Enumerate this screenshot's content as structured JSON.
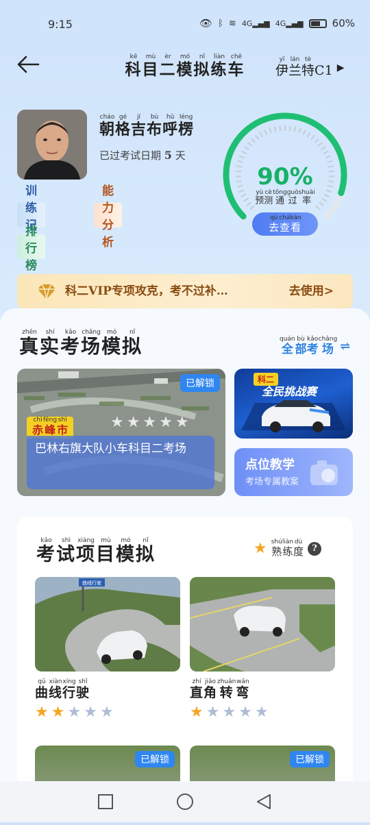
{
  "status_bar": {
    "time": "9:15",
    "battery": "60%",
    "signal1": "4G",
    "signal2": "4G"
  },
  "header": {
    "title": "科目二模拟练车",
    "title_pinyin": [
      "kē",
      "mù",
      "èr",
      "mó",
      "nǐ",
      "liàn",
      "chē"
    ],
    "vehicle": "伊兰特C1",
    "vehicle_pinyin": [
      "yī",
      "lán",
      "tè"
    ]
  },
  "profile": {
    "name": "朝格吉布呼楞",
    "name_pinyin": [
      "cháo",
      "gé",
      "jí",
      "bù",
      "hū",
      "léng"
    ],
    "days_text": "已过考试日期",
    "days_num": "5",
    "days_unit": "天"
  },
  "tabs": {
    "record": "训练记录",
    "ability": "能力分析",
    "rank": "排行榜"
  },
  "gauge": {
    "percent": "90%",
    "percent_value": 0.9,
    "label": "预测通过率",
    "label_pinyin": [
      "yù",
      "cè",
      "tōng",
      "guò",
      "shuài"
    ],
    "button": "去查看",
    "button_pinyin": [
      "qù",
      "chá",
      "kàn"
    ]
  },
  "vip": {
    "text": "科二VIP专项攻克，考不过补…",
    "use": "去使用>"
  },
  "section1": {
    "title": "真实考场模拟",
    "title_pinyin": [
      "zhēn",
      "shí",
      "kǎo",
      "chǎng",
      "mó",
      "nǐ"
    ],
    "all": "全部考场",
    "all_pinyin": [
      "quán",
      "bù",
      "kǎo",
      "chǎng"
    ]
  },
  "venue": {
    "unlock": "已解锁",
    "city": "赤峰市",
    "city_pinyin": [
      "chì",
      "fēng",
      "shì"
    ],
    "stars": "★★★★★",
    "star_rating": 0,
    "name": "巴林右旗大队小车科目二考场"
  },
  "challenge": {
    "tag": "科二",
    "title": "全民挑战赛"
  },
  "point_teach": {
    "title": "点位教学",
    "subtitle": "考场专属教案"
  },
  "section2": {
    "title": "考试项目模拟",
    "title_pinyin": [
      "kǎo",
      "shì",
      "xiàng",
      "mù",
      "mó",
      "nǐ"
    ],
    "proficiency": "熟练度",
    "proficiency_pinyin": [
      "shú",
      "liàn",
      "dù"
    ]
  },
  "items": [
    {
      "name": "曲线行驶",
      "pinyin": [
        "qū",
        "xiàn",
        "xíng",
        "shǐ"
      ],
      "rating": 2,
      "sign": "曲线行驶"
    },
    {
      "name": "直角转弯",
      "pinyin": [
        "zhí",
        "jiǎo",
        "zhuǎn",
        "wān"
      ],
      "rating": 1
    },
    {
      "unlock": "已解锁"
    },
    {
      "unlock": "已解锁"
    }
  ],
  "colors": {
    "accent_blue": "#2f86f0",
    "gauge_green": "#18b068",
    "vip_brown": "#8a4a12",
    "star_gold": "#f5a623"
  }
}
